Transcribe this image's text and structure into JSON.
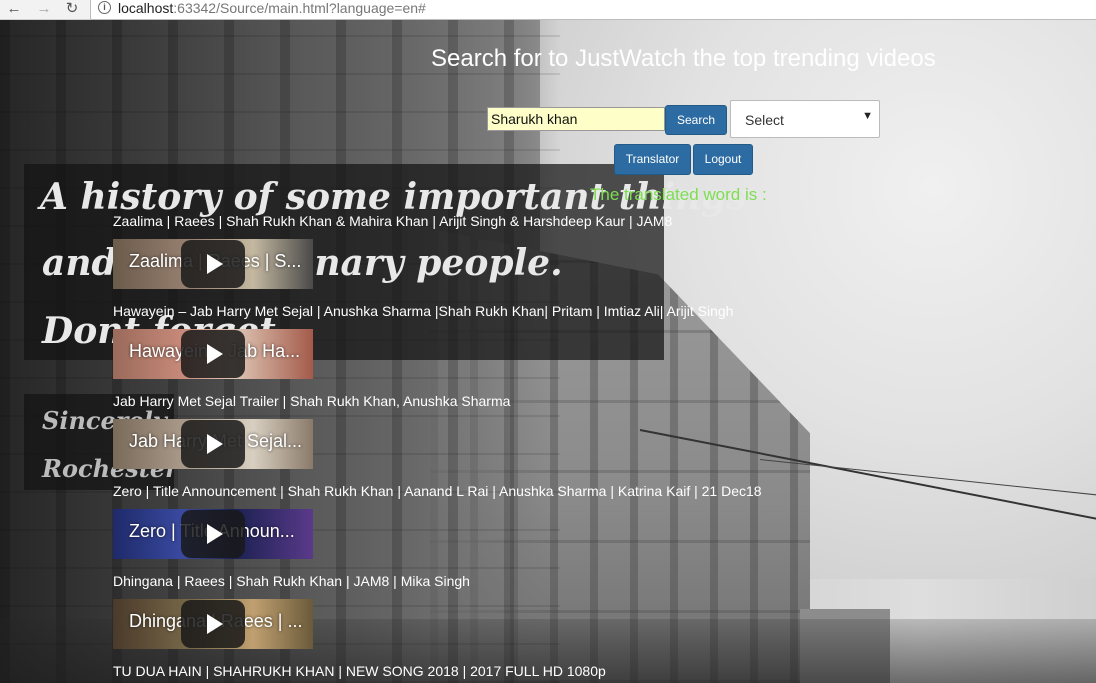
{
  "browser": {
    "url_host": "localhost",
    "url_path": ":63342/Source/main.html?language=en#"
  },
  "background": {
    "sign_lines": [
      "A history of some important things",
      "and extraordinary people.",
      "Dont forget"
    ],
    "sign2_lines": [
      "Sincerely,",
      "Rochester"
    ]
  },
  "page": {
    "heading": "Search for to JustWatch the top trending videos",
    "search_value": "Sharukh khan",
    "search_button": "Search",
    "select_value": "Select",
    "translator_button": "Translator",
    "logout_button": "Logout",
    "translated_label": "The translated word is :"
  },
  "videos": [
    {
      "title": "Zaalima | Raees | Shah Rukh Khan & Mahira Khan | Arijit Singh & Harshdeep Kaur | JAM8",
      "thumb_text": "Zaalima | Raees | S..."
    },
    {
      "title": "Hawayein – Jab Harry Met Sejal | Anushka Sharma |Shah Rukh Khan| Pritam | Imtiaz Ali| Arijit Singh",
      "thumb_text": "Hawayein – Jab Ha..."
    },
    {
      "title": "Jab Harry Met Sejal Trailer | Shah Rukh Khan, Anushka Sharma",
      "thumb_text": "Jab Harry Met Sejal..."
    },
    {
      "title": "Zero | Title Announcement | Shah Rukh Khan | Aanand L Rai | Anushka Sharma | Katrina Kaif | 21 Dec18",
      "thumb_text": "Zero | Title Announ..."
    },
    {
      "title": "Dhingana | Raees | Shah Rukh Khan | JAM8 | Mika Singh",
      "thumb_text": "Dhingana | Raees | ..."
    },
    {
      "title": "TU DUA HAIN | SHAHRUKH KHAN | NEW SONG 2018 | 2017 FULL HD 1080p"
    }
  ]
}
